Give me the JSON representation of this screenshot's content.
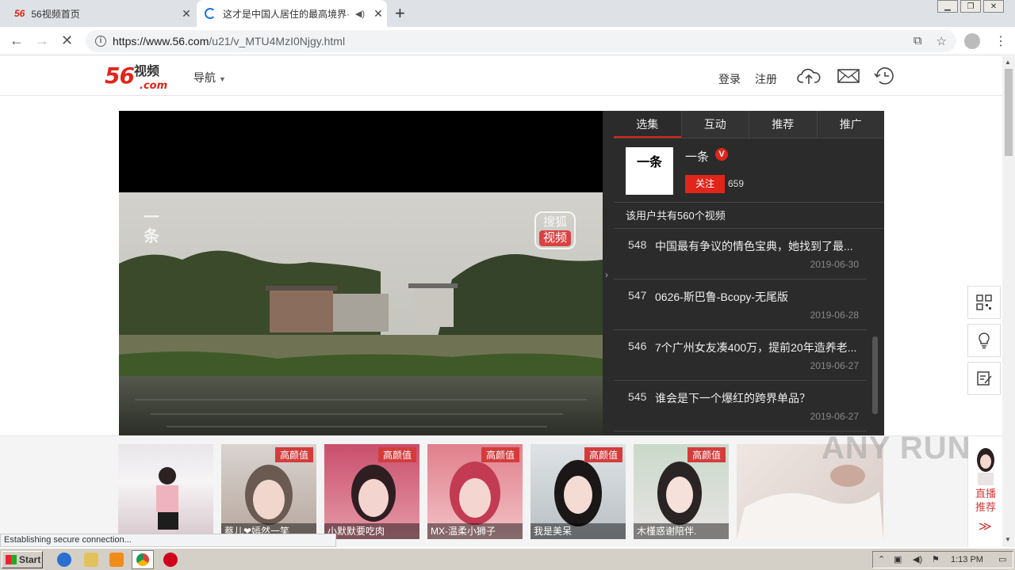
{
  "browser": {
    "tabs": [
      {
        "favicon": "56",
        "title": "56视频首页",
        "close": "✕"
      },
      {
        "title": "这才是中国人居住的最高境界·中",
        "close": "✕"
      }
    ],
    "new_tab": "+",
    "url_host": "https://www.56.com",
    "url_path": "/u21/v_MTU4MzI0Njgy.html"
  },
  "site": {
    "logo_num": "56",
    "logo_cn": "视频",
    "logo_com": ".com",
    "nav_label": "导航",
    "login": "登录",
    "register": "注册"
  },
  "player": {
    "watermark_left": "一条",
    "watermark_sohu_top": "搜狐",
    "watermark_sohu_bottom": "视频"
  },
  "side": {
    "tabs": [
      "选集",
      "互动",
      "推荐",
      "推广"
    ],
    "author_avatar_text": "一条",
    "author_name": "一条",
    "verified_badge": "V",
    "follow_label": "关注",
    "follow_count": "659",
    "total_text": "该用户共有560个视频",
    "videos": [
      {
        "num": "548",
        "title": "中国最有争议的情色宝典，她找到了最...",
        "date": "2019-06-30"
      },
      {
        "num": "547",
        "title": "0626-斯巴鲁-Bcopy-无尾版",
        "date": "2019-06-28"
      },
      {
        "num": "546",
        "title": "7个广州女友凑400万，提前20年造养老...",
        "date": "2019-06-27"
      },
      {
        "num": "545",
        "title": "谁会是下一个爆红的跨界单品？",
        "date": "2019-06-27"
      }
    ]
  },
  "recommend": {
    "badge_label": "高颜值",
    "items": [
      {
        "name": ""
      },
      {
        "name": "蔡儿❤嫣然一笑"
      },
      {
        "name": "小默默要吃肉"
      },
      {
        "name": "MX-温柔小狮子"
      },
      {
        "name": "我是美呆"
      },
      {
        "name": "木槿惑谢陪伴."
      },
      {
        "name": ""
      }
    ],
    "live_label": "直播推荐",
    "live_arrows": "≫"
  },
  "watermark": "ANY RUN",
  "status_text": "Establishing secure connection...",
  "taskbar": {
    "start": "Start",
    "time": "1:13 PM"
  },
  "colors": {
    "brand_red": "#e1251b",
    "side_bg": "#2b2b2b"
  }
}
